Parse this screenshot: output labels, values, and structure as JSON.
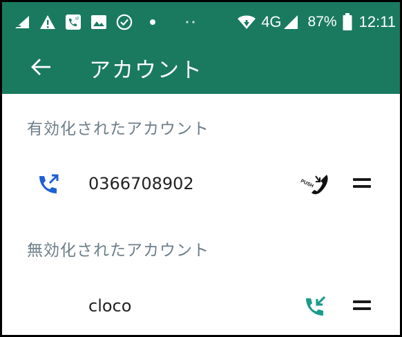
{
  "status_bar": {
    "network": "4G",
    "battery": "87%",
    "time": "12:11",
    "left_icons": [
      "sim-alert-icon",
      "warning-icon",
      "voip-icon",
      "image-icon",
      "check-circle-icon",
      "dot-icon",
      "more-dots-icon"
    ]
  },
  "app_bar": {
    "title": "アカウント",
    "back_icon": "arrow-left-icon"
  },
  "sections": {
    "enabled_header": "有効化されたアカウント",
    "disabled_header": "無効化されたアカウント"
  },
  "accounts": {
    "enabled": [
      {
        "label": "0366708902",
        "lead_icon": "phone-outgoing-icon",
        "status_icon": "push-call-icon",
        "status_text": "PUSH"
      }
    ],
    "disabled": [
      {
        "label": "cloco",
        "status_icon": "phone-incoming-icon"
      }
    ]
  },
  "colors": {
    "primary": "#1a7a60",
    "accent_blue": "#1e5fd6",
    "accent_teal": "#1a9c8a",
    "section_header": "#6c7e89"
  }
}
